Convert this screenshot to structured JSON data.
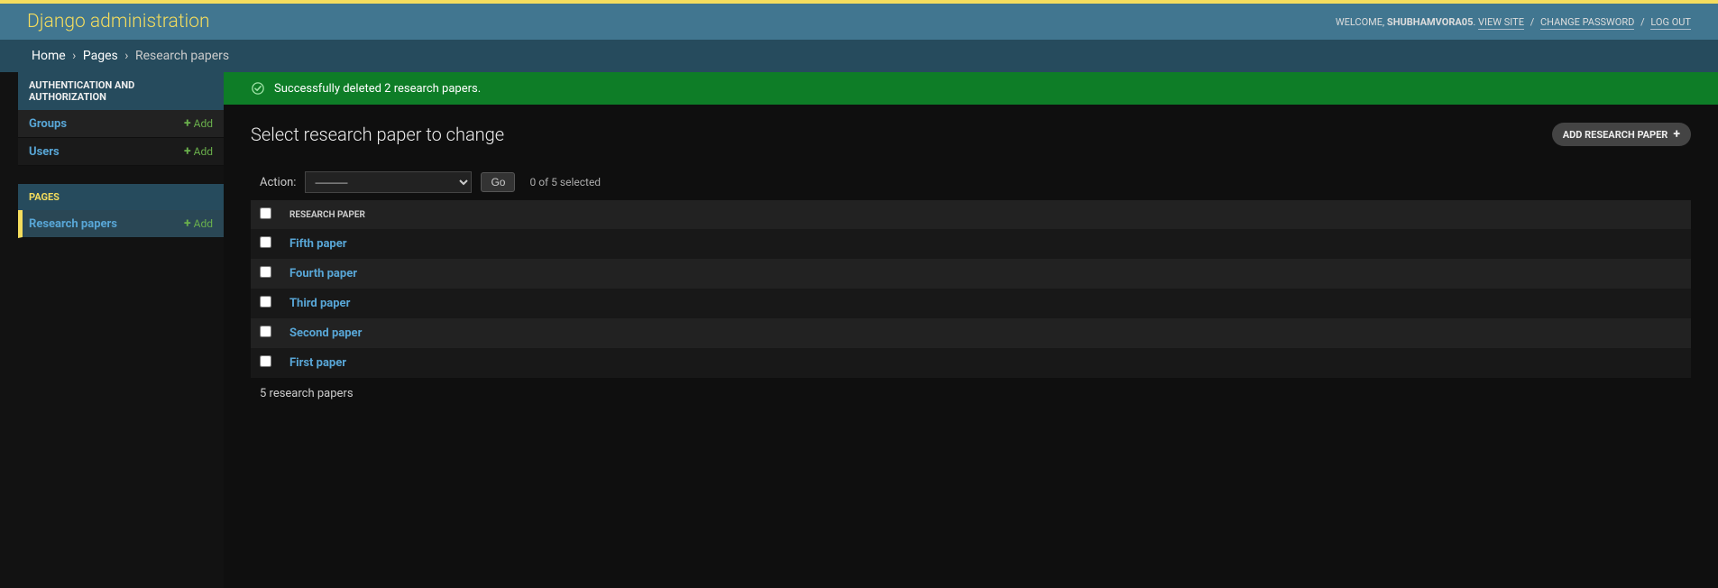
{
  "header": {
    "title": "Django administration",
    "welcome": "WELCOME,",
    "username": "SHUBHAMVORA05",
    "links": {
      "view_site": "VIEW SITE",
      "change_password": "CHANGE PASSWORD",
      "log_out": "LOG OUT"
    }
  },
  "breadcrumbs": {
    "items": [
      "Home",
      "Pages",
      "Research papers"
    ]
  },
  "sidebar": {
    "sections": [
      {
        "caption": "AUTHENTICATION AND AUTHORIZATION",
        "models": [
          {
            "name": "Groups",
            "add": "Add",
            "active": false
          },
          {
            "name": "Users",
            "add": "Add",
            "active": false
          }
        ]
      },
      {
        "caption": "PAGES",
        "models": [
          {
            "name": "Research papers",
            "add": "Add",
            "active": true
          }
        ]
      }
    ]
  },
  "message": "Successfully deleted 2 research papers.",
  "page": {
    "title": "Select research paper to change",
    "add_button": "ADD RESEARCH PAPER"
  },
  "actions": {
    "label": "Action:",
    "placeholder": "———",
    "go": "Go",
    "counter": "0 of 5 selected"
  },
  "table": {
    "header": "RESEARCH PAPER",
    "rows": [
      {
        "title": "Fifth paper"
      },
      {
        "title": "Fourth paper"
      },
      {
        "title": "Third paper"
      },
      {
        "title": "Second paper"
      },
      {
        "title": "First paper"
      }
    ],
    "footer": "5 research papers"
  }
}
